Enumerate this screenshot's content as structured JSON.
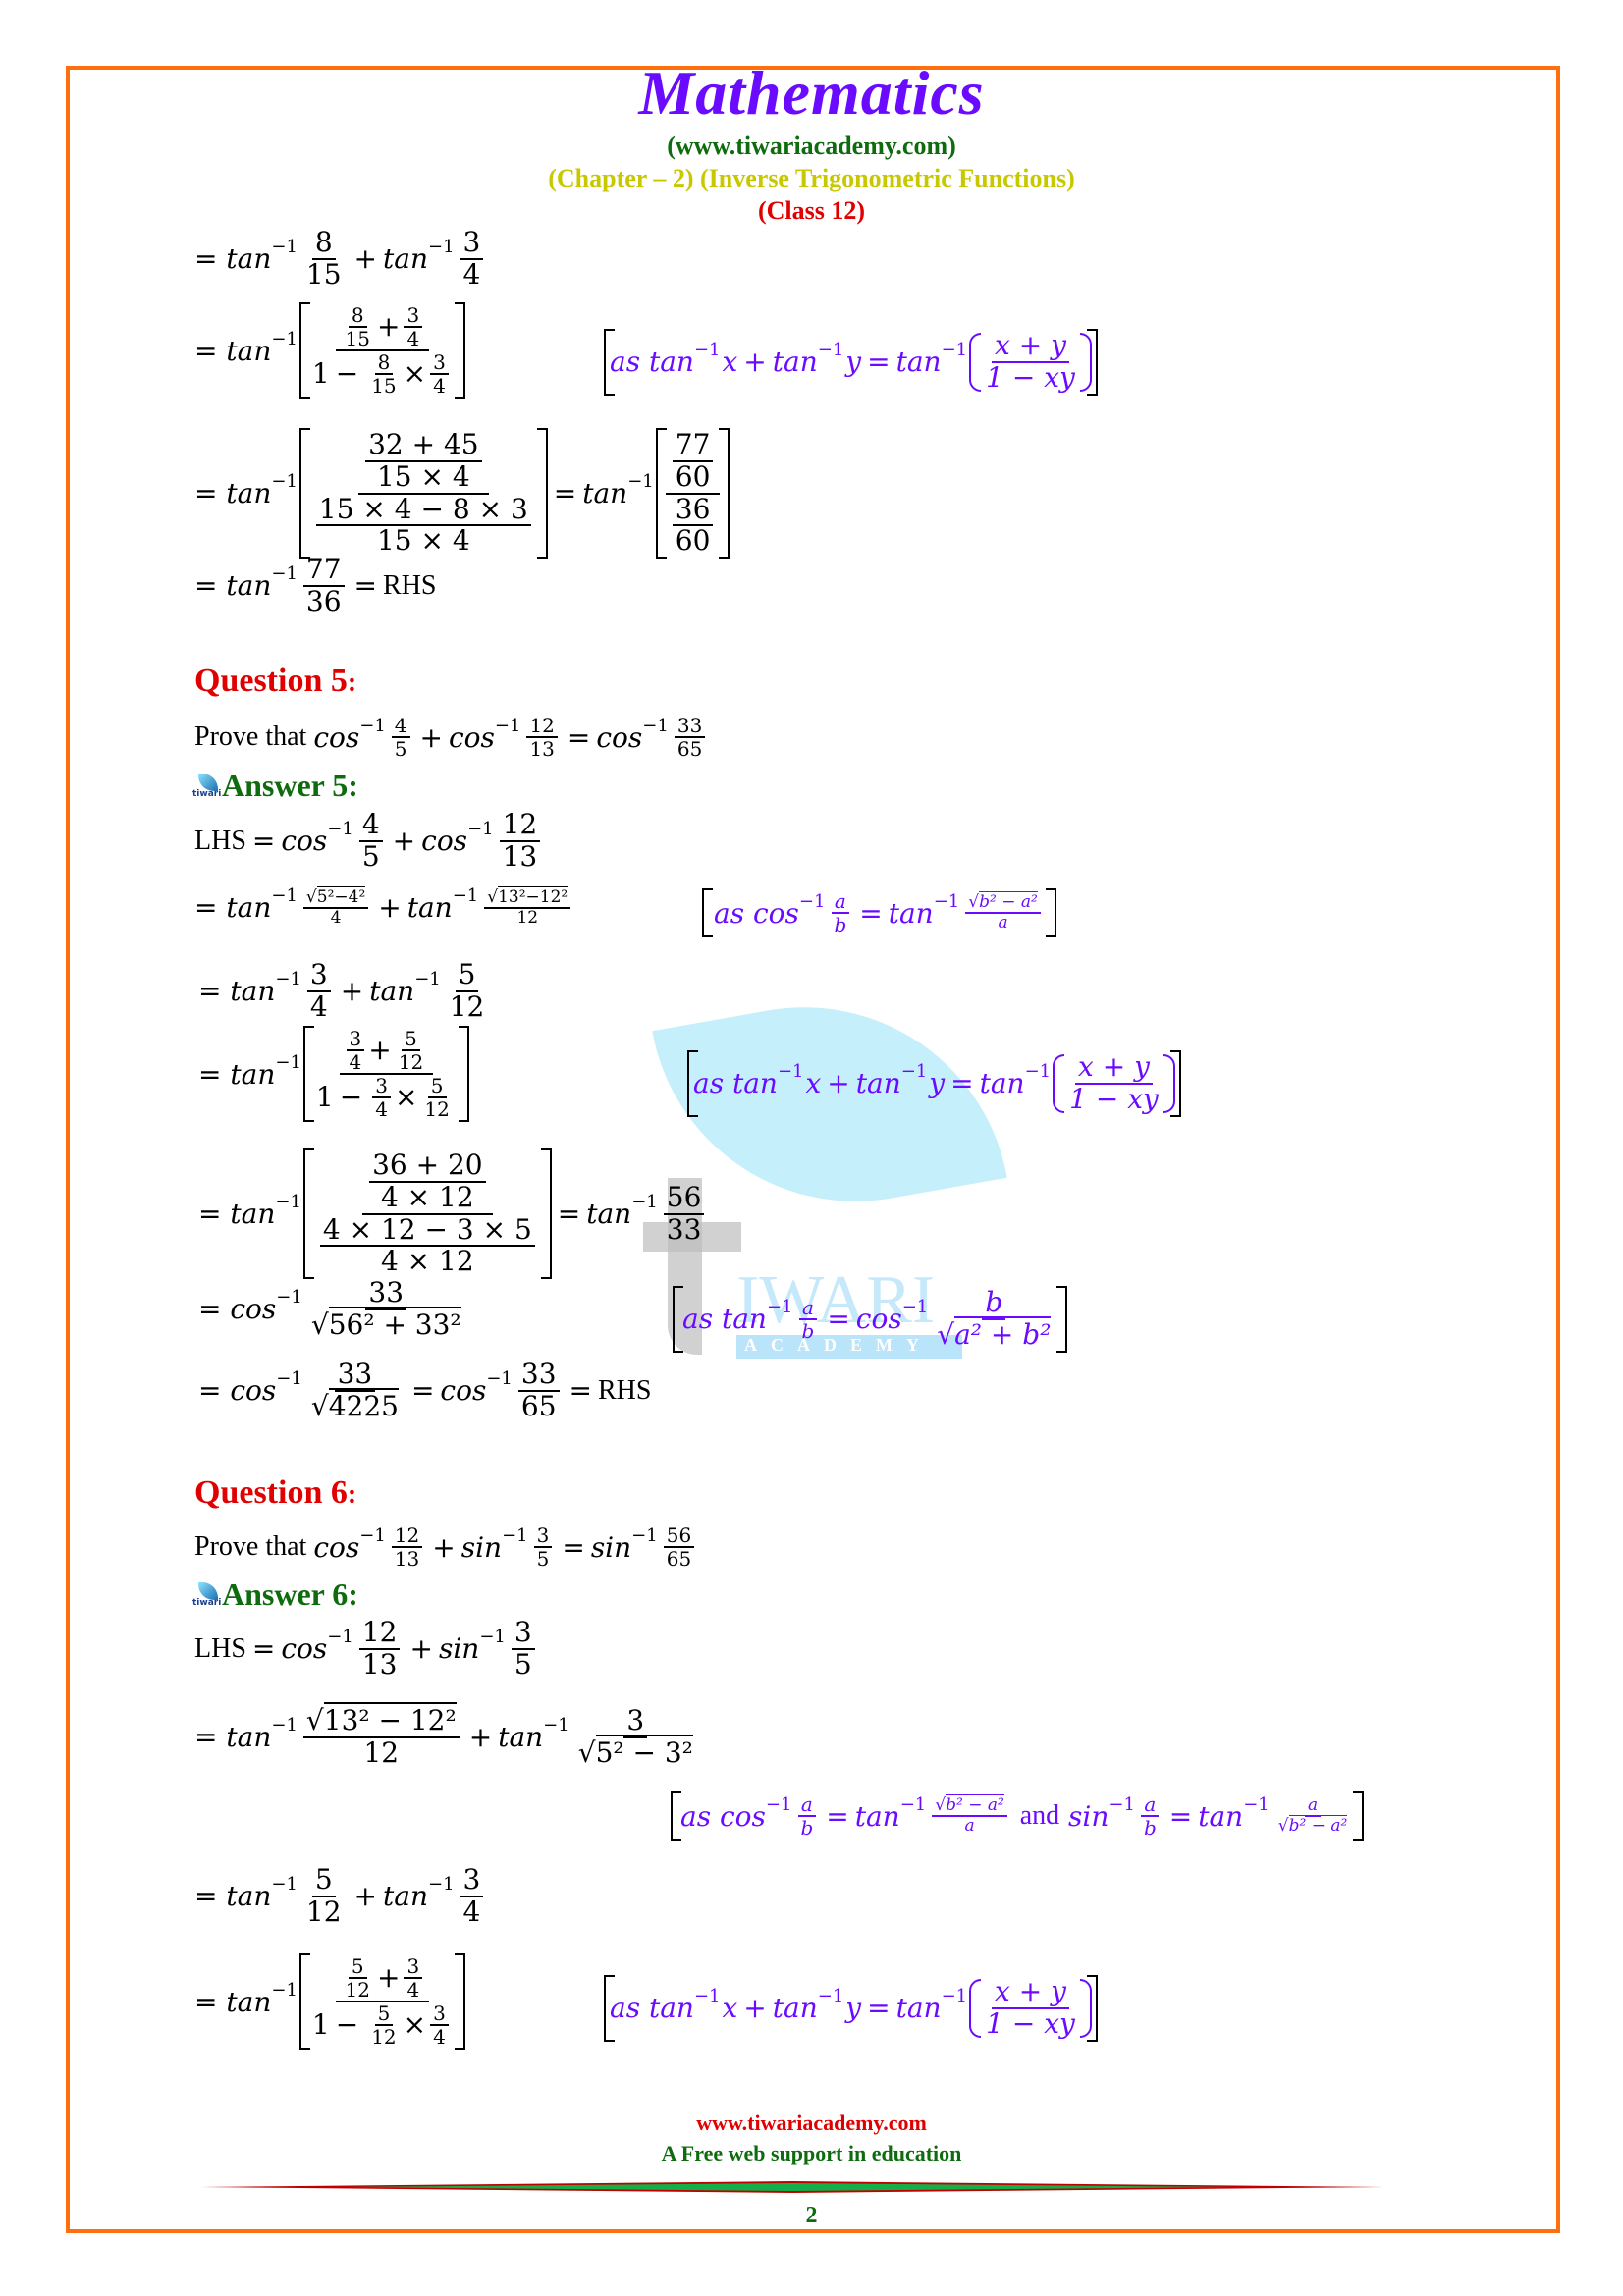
{
  "header": {
    "title": "Mathematics",
    "website": "(www.tiwariacademy.com)",
    "chapter": "(Chapter – 2) (Inverse Trigonometric Functions)",
    "class": "(Class 12)"
  },
  "colors": {
    "border": "#FF6F10",
    "title": "#6A0BFF",
    "website": "#0E6B0E",
    "chapter": "#C8C800",
    "class": "#E00000",
    "question": "#E00000",
    "answer": "#0E6B0E",
    "hint": "#6A0BFF"
  },
  "sym": {
    "eq": "=",
    "plus": "+",
    "minus": "−",
    "times": "×",
    "inv": "−1",
    "tan": "tan",
    "cos": "cos",
    "sin": "sin",
    "rad": "√",
    "lhs": "LHS",
    "rhs": "RHS",
    "as": "as",
    "and": "and",
    "x": "x",
    "y": "y",
    "a": "a",
    "b": "b",
    "one": "1",
    "xplusy": "x + y",
    "oneminusxy": "1 − xy",
    "b2a2": "b² − a²",
    "a2b2": "a² + b²"
  },
  "q4_tail": {
    "line1": {
      "f1": [
        "8",
        "15"
      ],
      "f2": [
        "3",
        "4"
      ]
    },
    "line2": {
      "f1": [
        "8",
        "15"
      ],
      "f2": [
        "3",
        "4"
      ],
      "f3": [
        "8",
        "15"
      ],
      "f4": [
        "3",
        "4"
      ]
    },
    "line3": {
      "num_top": "32 + 45",
      "num_bot": "15 × 4",
      "den_top": "15 × 4 − 8 × 3",
      "den_bot": "15 × 4",
      "r1": [
        "77",
        "60"
      ],
      "r2": [
        "36",
        "60"
      ]
    },
    "line4": {
      "f": [
        "77",
        "36"
      ]
    }
  },
  "question5": {
    "label": "Question 5",
    "prove_text": "Prove that",
    "statement": {
      "f1": [
        "4",
        "5"
      ],
      "f2": [
        "12",
        "13"
      ],
      "f3": [
        "33",
        "65"
      ]
    },
    "answer_label": "Answer 5",
    "steps": {
      "s1": {
        "f1": [
          "4",
          "5"
        ],
        "f2": [
          "12",
          "13"
        ]
      },
      "s2": {
        "r1": "5²−4²",
        "d1": "4",
        "r2": "13²−12²",
        "d2": "12"
      },
      "s3": {
        "f1": [
          "3",
          "4"
        ],
        "f2": [
          "5",
          "12"
        ]
      },
      "s4": {
        "f1": [
          "3",
          "4"
        ],
        "f2": [
          "5",
          "12"
        ],
        "f3": [
          "3",
          "4"
        ],
        "f4": [
          "5",
          "12"
        ]
      },
      "s5": {
        "num_top": "36 + 20",
        "num_bot": "4 × 12",
        "den_top": "4 × 12 − 3 × 5",
        "den_bot": "4 × 12",
        "r": [
          "56",
          "33"
        ]
      },
      "s6": {
        "n": "33",
        "r": "56² + 33²"
      },
      "s7": {
        "n": "33",
        "r": "4225",
        "f": [
          "33",
          "65"
        ]
      }
    }
  },
  "question6": {
    "label": "Question 6",
    "prove_text": "Prove that",
    "statement": {
      "f1": [
        "12",
        "13"
      ],
      "f2": [
        "3",
        "5"
      ],
      "f3": [
        "56",
        "65"
      ]
    },
    "answer_label": "Answer 6",
    "steps": {
      "s1": {
        "f1": [
          "12",
          "13"
        ],
        "f2": [
          "3",
          "5"
        ]
      },
      "s2": {
        "r1": "13² − 12²",
        "d1": "12",
        "n2": "3",
        "r2": "5² − 3²"
      },
      "s3": {
        "f1": [
          "5",
          "12"
        ],
        "f2": [
          "3",
          "4"
        ]
      },
      "s4": {
        "f1": [
          "5",
          "12"
        ],
        "f2": [
          "3",
          "4"
        ],
        "f3": [
          "5",
          "12"
        ],
        "f4": [
          "3",
          "4"
        ]
      }
    }
  },
  "footer": {
    "website": "www.tiwariacademy.com",
    "tagline": "A Free web support in education",
    "page_number": "2"
  },
  "watermark": {
    "word": "IWARI",
    "sub": "ACADEMY",
    "icon": "tiwari-leaf-logo"
  },
  "answer_icon_text": "tiwari"
}
